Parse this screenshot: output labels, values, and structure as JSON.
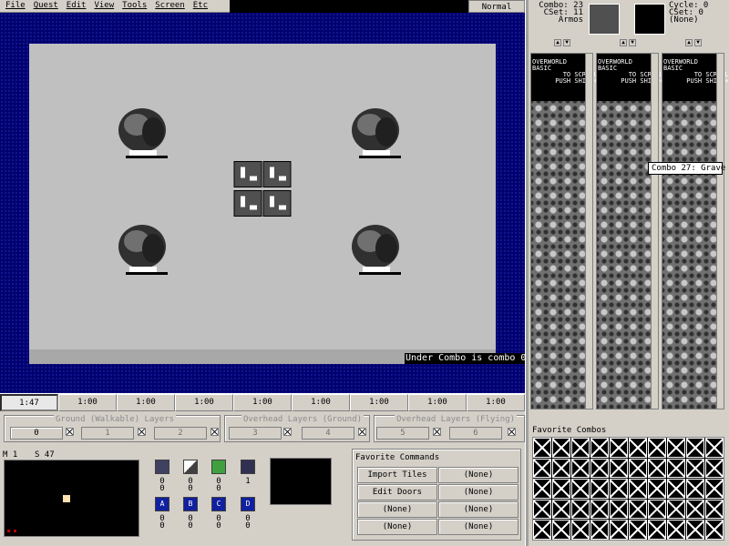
{
  "menu": [
    "File",
    "Quest",
    "Edit",
    "View",
    "Tools",
    "Screen",
    "Etc"
  ],
  "mode": "Normal",
  "under_combo": "Under Combo is combo 0",
  "layer_cells": [
    "1:47",
    "1:00",
    "1:00",
    "1:00",
    "1:00",
    "1:00",
    "1:00",
    "1:00",
    "1:00"
  ],
  "layer_groups": {
    "ground": {
      "title": "Ground (Walkable) Layers",
      "buttons": [
        "0",
        "1",
        "2"
      ]
    },
    "overhead_ground": {
      "title": "Overhead Layers (Ground)",
      "buttons": [
        "3",
        "4"
      ]
    },
    "overhead_flying": {
      "title": "Overhead Layers (Flying)",
      "buttons": [
        "5",
        "6"
      ]
    }
  },
  "map_label": {
    "map": "M 1",
    "screen": "S 47"
  },
  "flags": {
    "row1_values": [
      [
        "0",
        "0"
      ],
      [
        "0",
        "0"
      ],
      [
        "0",
        "0"
      ],
      [
        "1"
      ]
    ],
    "row2_values": [
      [
        "0",
        "0"
      ],
      [
        "0",
        "0"
      ],
      [
        "0",
        "0"
      ],
      [
        "0",
        "0"
      ]
    ],
    "row2_letters": [
      "A",
      "B",
      "C",
      "D"
    ]
  },
  "favorite_commands": {
    "title": "Favorite Commands",
    "items": [
      [
        "Import Tiles",
        "(None)"
      ],
      [
        "Edit Doors",
        "(None)"
      ],
      [
        "(None)",
        "(None)"
      ],
      [
        "(None)",
        "(None)"
      ]
    ]
  },
  "combo_info": {
    "combo": "Combo: 23",
    "cset": "CSet: 11",
    "type": "Armos",
    "cycle": "Cycle: 0",
    "cset2": "CSet: 0",
    "none": "(None)"
  },
  "column_header": "OVERWORLD\nBASIC\n        TO SCROLL\n      PUSH SHIFT+↑↓",
  "tooltip": "Combo 27: Grave",
  "favorite_combos_title": "Favorite Combos",
  "colors": {
    "water": "#00006e",
    "grass": "#c0c0c0",
    "panel": "#d4d0c8"
  }
}
